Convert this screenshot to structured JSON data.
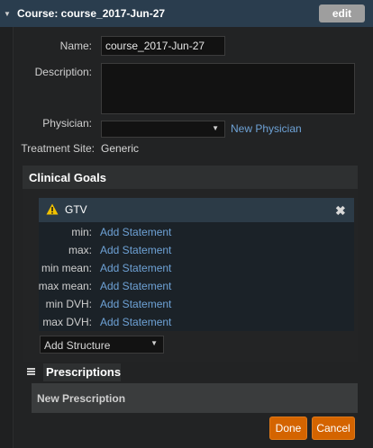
{
  "header": {
    "title": "Course: course_2017-Jun-27",
    "edit_label": "edit"
  },
  "form": {
    "name_label": "Name:",
    "name_value": "course_2017-Jun-27",
    "description_label": "Description:",
    "description_value": "",
    "physician_label": "Physician:",
    "physician_value": "",
    "new_physician_label": "New Physician",
    "treatment_site_label": "Treatment Site:",
    "treatment_site_value": "Generic"
  },
  "clinical_goals": {
    "title": "Clinical Goals",
    "structure": {
      "name": "GTV",
      "goals": [
        {
          "label": "min:",
          "action": "Add Statement"
        },
        {
          "label": "max:",
          "action": "Add Statement"
        },
        {
          "label": "min mean:",
          "action": "Add Statement"
        },
        {
          "label": "max mean:",
          "action": "Add Statement"
        },
        {
          "label": "min DVH:",
          "action": "Add Statement"
        },
        {
          "label": "max DVH:",
          "action": "Add Statement"
        }
      ]
    },
    "add_structure_label": "Add Structure"
  },
  "prescriptions": {
    "title": "Prescriptions",
    "new_prescription_label": "New Prescription"
  },
  "footer": {
    "done_label": "Done",
    "cancel_label": "Cancel"
  },
  "colors": {
    "header_bg": "#2a3d4e",
    "link": "#6ea2d6",
    "accent_orange": "#d46400",
    "warning_yellow": "#f2c200"
  },
  "icons": {
    "collapse": "triangle-down-icon",
    "warning": "warning-icon",
    "remove": "close-icon",
    "list": "list-icon"
  }
}
